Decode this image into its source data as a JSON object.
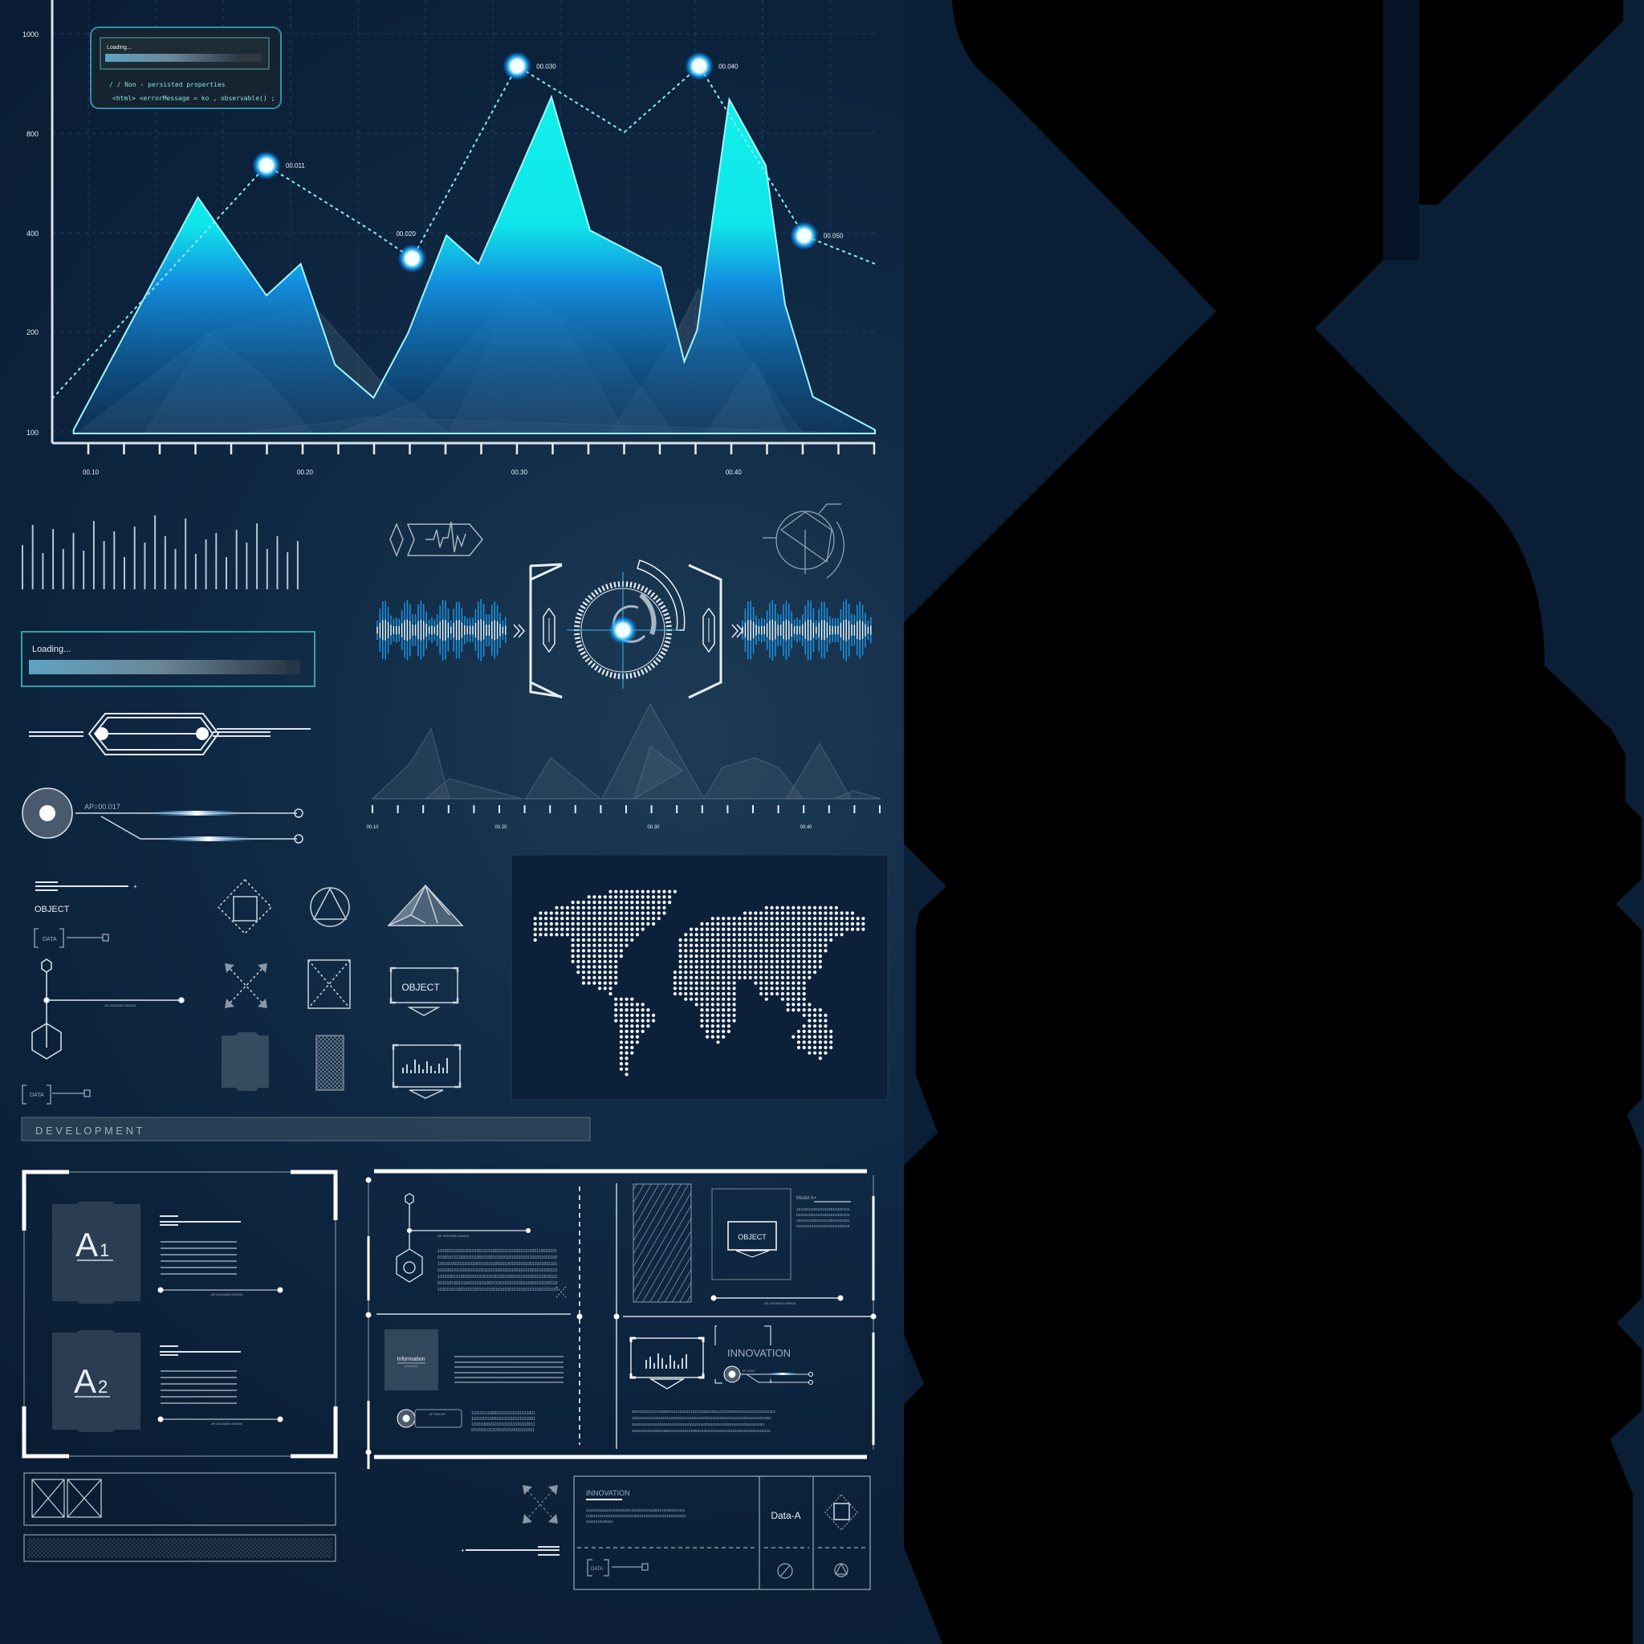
{
  "colors": {
    "background": "#0b1f37",
    "black": "#000000",
    "accent": "#19e6ea",
    "accent_blue": "#1a8fe0",
    "line": "#e6edf3",
    "muted": "#8fa3b5"
  },
  "code_box": {
    "loading_label": "Loading...",
    "progress": 0.85,
    "code_line_1": "/ / Non - persisted properties",
    "code_line_2": "<html> <errorMessage = ko , observable() ;"
  },
  "chart_data": {
    "type": "area",
    "title": "",
    "xlabel": "",
    "ylabel": "",
    "yticks": [
      1000,
      800,
      400,
      200,
      100
    ],
    "xticks": [
      {
        "value": 0.1,
        "label": "00.10"
      },
      {
        "value": 0.2,
        "label": "00.20"
      },
      {
        "value": 0.3,
        "label": "00.30"
      },
      {
        "value": 0.4,
        "label": "00.40"
      }
    ],
    "xlim": [
      0.082,
      0.466
    ],
    "grid": true,
    "area_series": {
      "name": "main",
      "x": [
        0.092,
        0.15,
        0.182,
        0.198,
        0.214,
        0.232,
        0.248,
        0.266,
        0.281,
        0.315,
        0.333,
        0.366,
        0.377,
        0.383,
        0.398,
        0.415,
        0.424,
        0.437,
        0.466
      ],
      "y": [
        102,
        542,
        273,
        337,
        167,
        134,
        198,
        395,
        337,
        873,
        410,
        330,
        170,
        203,
        868,
        671,
        255,
        135,
        102
      ]
    },
    "line_series": {
      "name": "trend",
      "x": [
        0.082,
        0.182,
        0.232,
        0.25,
        0.299,
        0.349,
        0.384,
        0.433,
        0.466
      ],
      "y": [
        133,
        671,
        403,
        348,
        935,
        802,
        935,
        394,
        337
      ]
    },
    "markers": [
      {
        "x": 0.182,
        "y": 671,
        "label": "00.011"
      },
      {
        "x": 0.25,
        "y": 348,
        "label": "00.020"
      },
      {
        "x": 0.299,
        "y": 935,
        "label": "00.030"
      },
      {
        "x": 0.384,
        "y": 935,
        "label": "00.040"
      },
      {
        "x": 0.433,
        "y": 394,
        "label": "00.050"
      }
    ]
  },
  "loading_panel": {
    "label": "Loading...",
    "progress": 0.95
  },
  "knob_label": "AP=00.017",
  "mini_axis": {
    "labels": [
      "00.10",
      "00.20",
      "00.30",
      "00.40"
    ]
  },
  "object_block": {
    "title": "OBJECT",
    "data_tag_1": "DATA",
    "data_tag_2": "DATA",
    "node_caption": "AP-00100000.000000"
  },
  "icons": {
    "object_box_label": "OBJECT"
  },
  "development_bar": {
    "label": "D E V E L O P M E N T"
  },
  "a_panel": {
    "card_1": "A",
    "card_1_sub": "1",
    "card_2": "A",
    "card_2_sub": "2",
    "caption_1": "AP-00100000.000000",
    "caption_2": "AP-00100000.000000"
  },
  "big_panel": {
    "node_caption": "AP-00100000.000000",
    "binary_rows": [
      "1010010100110010100101010010110101001010100110010101",
      "0100101011001010100101001010101010010101101001010100",
      "1001010010110101001010101001010010101010010101001101",
      "0101001010100101010011010100101010010101001010100101",
      "1010100101001010101001010010101001010101001010010101",
      "0010101001010010101010010100101010100101001010100110",
      "1100101010010101001010100101010010101001010100101010"
    ],
    "object_label": "OBJECT",
    "model_label": "Model A+",
    "model_rows": [
      "1010010100101010010100101",
      "0101010010101001010100101",
      "1001010100101010010101001",
      "0101001010101001010100110"
    ],
    "frame_caption": "AP-00100000.000000",
    "information_title": "Information",
    "information_sub": "AP-0001000",
    "knob_tag": "AP-0001000",
    "binary_small": [
      "1101010100010101010101011001",
      "1101010100010101010101011001",
      "1010100001010101010101110011",
      "0010101011100101010011101011"
    ],
    "innovation_label": "INNOVATION",
    "innovation_knob_tag": "AP-00017",
    "binary_wide": [
      "0010100111010101000101010101010101011100110011101010100001010101010101011001",
      "1001010101010010101010100101010100110100101010100101010101001010101011001",
      "0100011101010100101010101010101011001100111010101000101010101010101001",
      "1010101010100001000011101101010100010100110101010101010100101010011010101"
    ]
  },
  "info_table": {
    "title": "INNOVATION",
    "rows": [
      "1010100111010100101010010101010101110010101001010101",
      "0100101010101010101010101001010101010010101010101010",
      "10101010100101"
    ],
    "data_label": "Data-A",
    "data_tag": "DATA"
  }
}
